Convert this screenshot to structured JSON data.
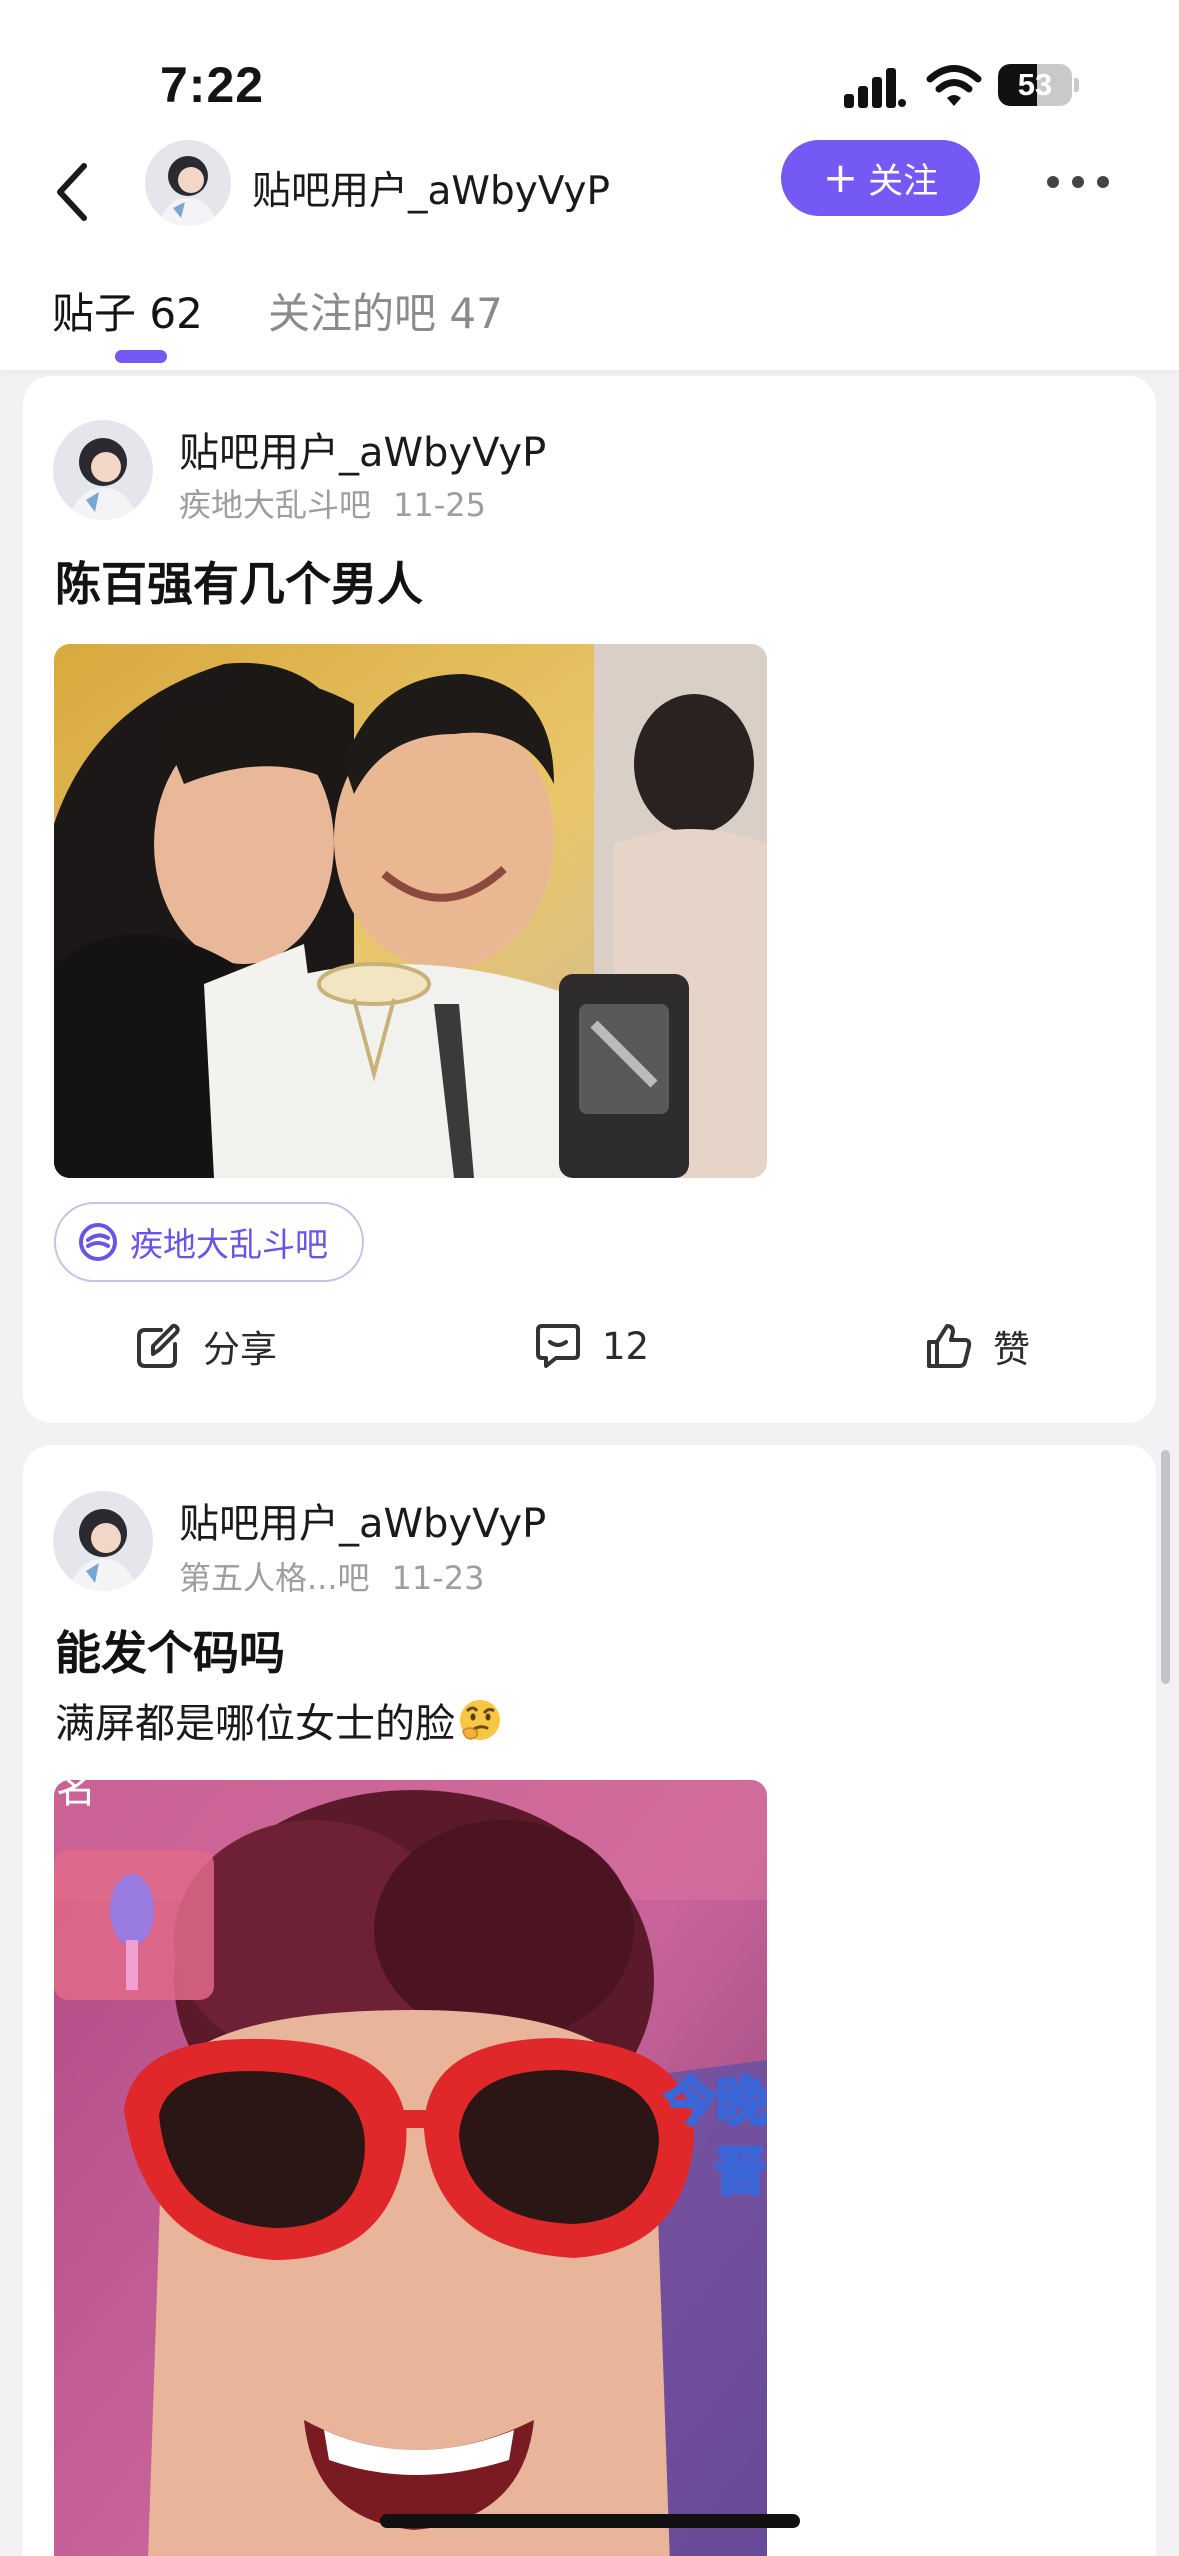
{
  "status_bar": {
    "time": "7:22",
    "battery": "53",
    "battery_level": 0.53
  },
  "header": {
    "username": "贴吧用户_aWbyVyP",
    "follow_label": "关注",
    "follow_plus": "+"
  },
  "tabs": [
    {
      "label": "贴子",
      "count": "62",
      "active": true
    },
    {
      "label": "关注的吧",
      "count": "47",
      "active": false
    }
  ],
  "posts": [
    {
      "author": "贴吧用户_aWbyVyP",
      "forum": "疾地大乱斗吧",
      "date": "11-25",
      "title": "陈百强有几个男人",
      "tag": "疾地大乱斗吧",
      "actions": {
        "share": "分享",
        "comments": "12",
        "like": "赞"
      }
    },
    {
      "author": "贴吧用户_aWbyVyP",
      "forum": "第五人格...吧",
      "date": "11-23",
      "title": "能发个码吗",
      "body": "满屏都是哪位女士的脸",
      "body_emoji": "thinking-face-emoji",
      "image_overlay_text": [
        "名",
        "今晚",
        "晋"
      ]
    }
  ],
  "colors": {
    "accent": "#7459f5",
    "background": "#f2f2f5",
    "muted_text": "#9d9da2"
  },
  "icons": [
    "back-arrow-icon",
    "more-dots-icon",
    "share-icon",
    "comment-icon",
    "thumbs-up-icon",
    "forum-logo-icon",
    "signal-icon",
    "wifi-icon"
  ]
}
